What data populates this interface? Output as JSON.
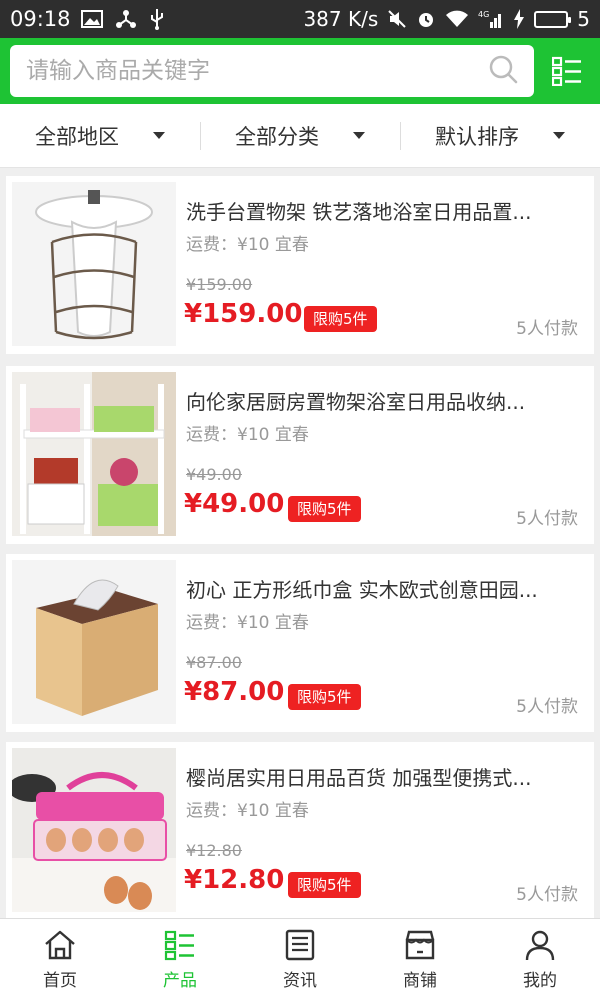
{
  "status_bar": {
    "time": "09:18",
    "network_speed": "387 K/s",
    "battery_level": "5",
    "signal_label": "4G",
    "left_icons": [
      "image-icon",
      "usb-share-icon",
      "usb-icon"
    ],
    "right_icons": [
      "mute-icon",
      "alarm-icon",
      "wifi-icon",
      "signal-icon",
      "charging-icon",
      "battery-icon"
    ]
  },
  "search": {
    "placeholder": "请输入商品关键字",
    "icon": "search-icon"
  },
  "menu_icon": "grid-list-icon",
  "filters": [
    {
      "label": "全部地区"
    },
    {
      "label": "全部分类"
    },
    {
      "label": "默认排序"
    }
  ],
  "products": [
    {
      "title": "洗手台置物架 铁艺落地浴室日用品置...",
      "shipping": "运费：¥10 宜春",
      "old_price": "¥159.00",
      "price": "¥159.00",
      "badge": "限购5件",
      "paid": "5人付款"
    },
    {
      "title": "向伦家居厨房置物架浴室日用品收纳...",
      "shipping": "运费：¥10 宜春",
      "old_price": "¥49.00",
      "price": "¥49.00",
      "badge": "限购5件",
      "paid": "5人付款"
    },
    {
      "title": "初心 正方形纸巾盒 实木欧式创意田园...",
      "shipping": "运费：¥10 宜春",
      "old_price": "¥87.00",
      "price": "¥87.00",
      "badge": "限购5件",
      "paid": "5人付款"
    },
    {
      "title": "樱尚居实用日用品百货 加强型便携式...",
      "shipping": "运费：¥10 宜春",
      "old_price": "¥12.80",
      "price": "¥12.80",
      "badge": "限购5件",
      "paid": "5人付款"
    }
  ],
  "bottom_nav": [
    {
      "label": "首页",
      "icon": "home-icon",
      "active": false
    },
    {
      "label": "产品",
      "icon": "product-grid-icon",
      "active": true
    },
    {
      "label": "资讯",
      "icon": "news-icon",
      "active": false
    },
    {
      "label": "商铺",
      "icon": "shop-icon",
      "active": false
    },
    {
      "label": "我的",
      "icon": "profile-icon",
      "active": false
    }
  ],
  "colors": {
    "brand_green": "#1ec334",
    "price_red": "#e51c23",
    "badge_red": "#ee2222",
    "status_bar": "#2e2e2e"
  }
}
